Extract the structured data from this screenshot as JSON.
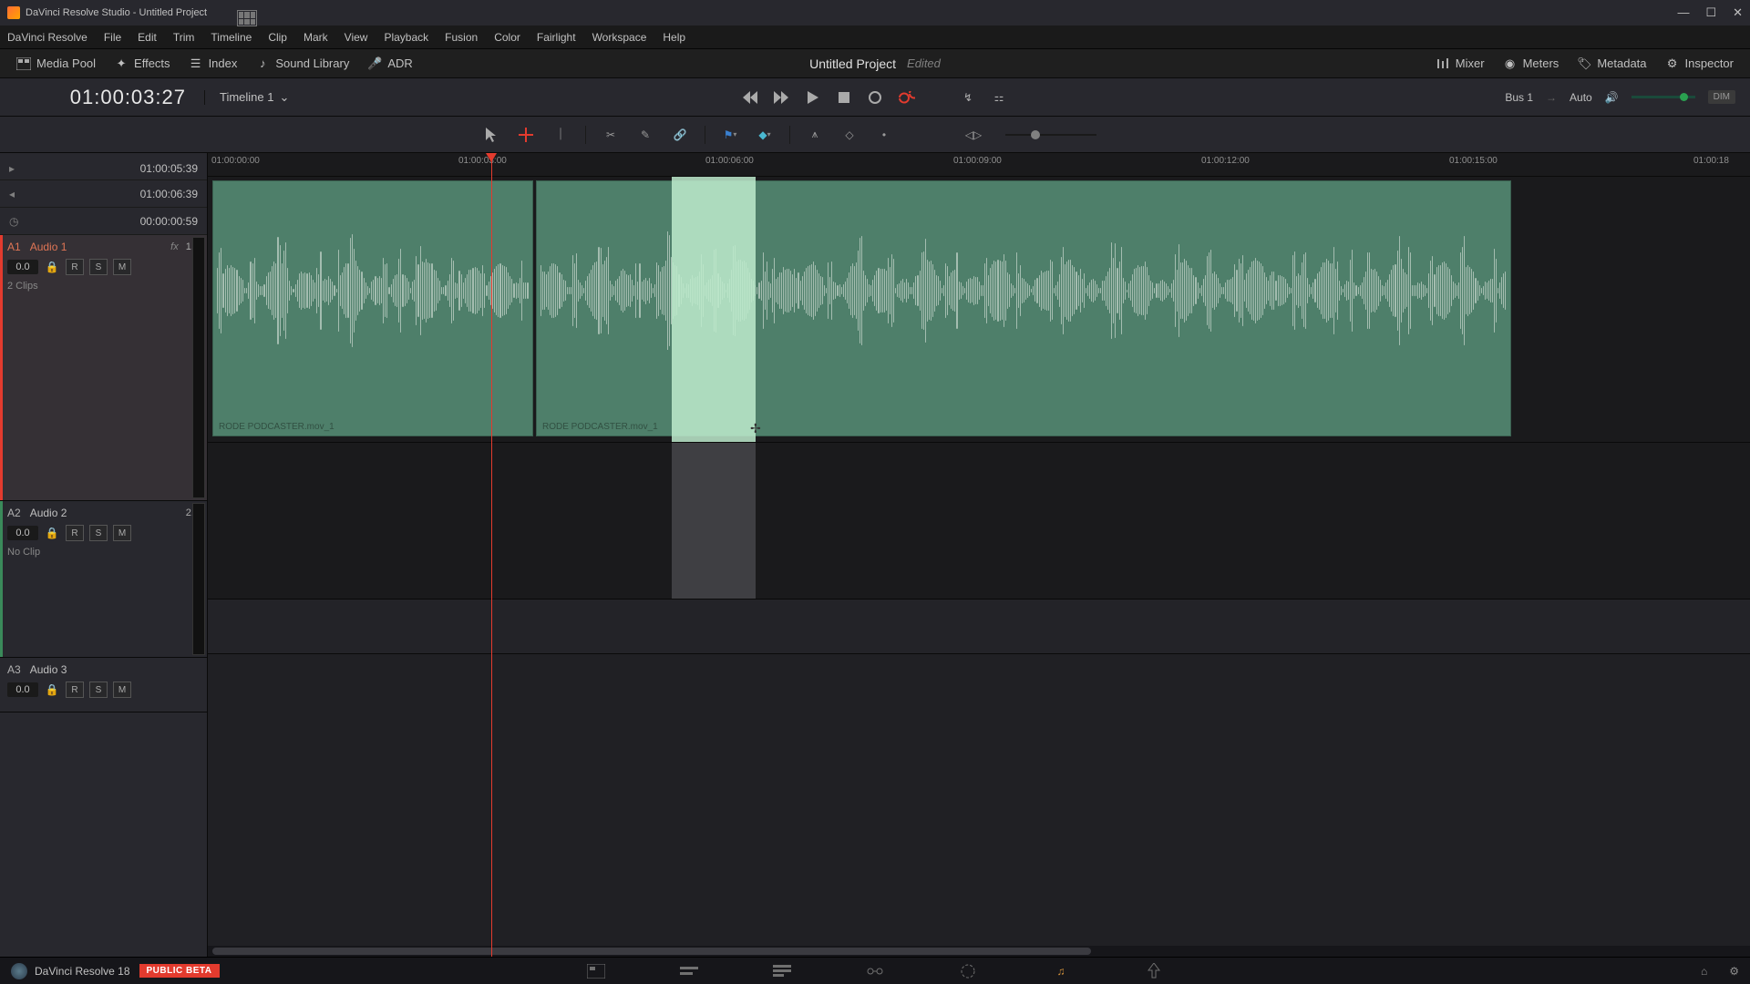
{
  "window": {
    "title": "DaVinci Resolve Studio - Untitled Project"
  },
  "menu": [
    "DaVinci Resolve",
    "File",
    "Edit",
    "Trim",
    "Timeline",
    "Clip",
    "Mark",
    "View",
    "Playback",
    "Fusion",
    "Color",
    "Fairlight",
    "Workspace",
    "Help"
  ],
  "panels": {
    "media_pool": "Media Pool",
    "effects": "Effects",
    "index": "Index",
    "sound_library": "Sound Library",
    "adr": "ADR",
    "mixer": "Mixer",
    "meters": "Meters",
    "metadata": "Metadata",
    "inspector": "Inspector"
  },
  "project": {
    "name": "Untitled Project",
    "status": "Edited"
  },
  "transport": {
    "timecode": "01:00:03:27",
    "timeline_name": "Timeline 1",
    "bus": "Bus 1",
    "auto": "Auto",
    "dim": "DIM"
  },
  "tc_rows": {
    "in": "01:00:05:39",
    "out": "01:00:06:39",
    "dur": "00:00:00:59"
  },
  "ruler": [
    "01:00:00:00",
    "01:00:03:00",
    "01:00:06:00",
    "01:00:09:00",
    "01:00:12:00",
    "01:00:15:00",
    "01:00:18"
  ],
  "tracks": {
    "a1": {
      "id": "A1",
      "name": "Audio 1",
      "fx": "fx",
      "gain": "1.0",
      "vol": "0.0",
      "clips": "2 Clips",
      "clip_name": "RODE PODCASTER.mov_1"
    },
    "a2": {
      "id": "A2",
      "name": "Audio 2",
      "gain": "2.0",
      "vol": "0.0",
      "clips": "No Clip"
    },
    "a3": {
      "id": "A3",
      "name": "Audio 3",
      "vol": "0.0"
    }
  },
  "buttons": {
    "r": "R",
    "s": "S",
    "m": "M"
  },
  "bottom": {
    "app": "DaVinci Resolve 18",
    "badge": "PUBLIC BETA"
  }
}
